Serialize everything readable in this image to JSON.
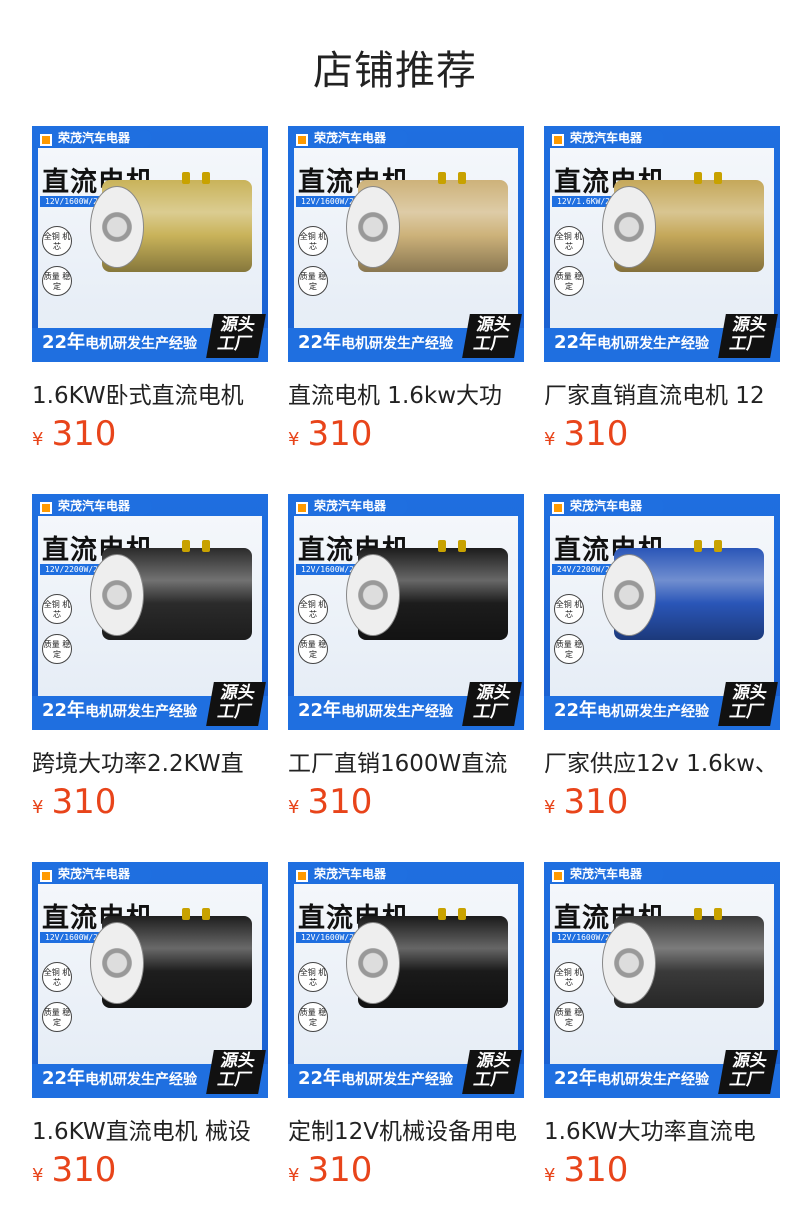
{
  "header": {
    "title": "店铺推荐"
  },
  "products": [
    {
      "brand": "荣茂汽车电器",
      "headline": "直流电机",
      "spec": "12V/1600W/2500RPM",
      "tag1": "全铜 机芯",
      "tag2": "质量 稳定",
      "years": "22年",
      "years_text": "电机研发生产经验",
      "source": "源头 工厂",
      "name": "1.6KW卧式直流电机",
      "currency": "¥",
      "price": "310",
      "motor_color": "#c9b35a"
    },
    {
      "brand": "荣茂汽车电器",
      "headline": "直流电机",
      "spec": "12V/1600W/2500RPM",
      "tag1": "全铜 机芯",
      "tag2": "质量 稳定",
      "years": "22年",
      "years_text": "电机研发生产经验",
      "source": "源头 工厂",
      "name": "直流电机 1.6kw大功",
      "currency": "¥",
      "price": "310",
      "motor_color": "#cdb27a"
    },
    {
      "brand": "荣茂汽车电器",
      "headline": "直流电机",
      "spec": "12V/1.6KW/2500RPM",
      "tag1": "全铜 机芯",
      "tag2": "质量 稳定",
      "years": "22年",
      "years_text": "电机研发生产经验",
      "source": "源头 工厂",
      "name": "厂家直销直流电机 12",
      "currency": "¥",
      "price": "310",
      "motor_color": "#c5a85a"
    },
    {
      "brand": "荣茂汽车电器",
      "headline": "直流电机",
      "spec": "12V/2200W/2700RPM",
      "tag1": "全铜 机芯",
      "tag2": "质量 稳定",
      "years": "22年",
      "years_text": "电机研发生产经验",
      "source": "源头 工厂",
      "name": "跨境大功率2.2KW直",
      "currency": "¥",
      "price": "310",
      "motor_color": "#2b2b2b"
    },
    {
      "brand": "荣茂汽车电器",
      "headline": "直流电机",
      "spec": "12V/1600W/2500RPM",
      "tag1": "全铜 机芯",
      "tag2": "质量 稳定",
      "years": "22年",
      "years_text": "电机研发生产经验",
      "source": "源头 工厂",
      "name": "工厂直销1600W直流",
      "currency": "¥",
      "price": "310",
      "motor_color": "#1c1c1c"
    },
    {
      "brand": "荣茂汽车电器",
      "headline": "直流电机",
      "spec": "24V/2200W/2700RPM",
      "tag1": "全铜 机芯",
      "tag2": "质量 稳定",
      "years": "22年",
      "years_text": "电机研发生产经验",
      "source": "源头 工厂",
      "name": "厂家供应12v 1.6kw、",
      "currency": "¥",
      "price": "310",
      "motor_color": "#2a56b8"
    },
    {
      "brand": "荣茂汽车电器",
      "headline": "直流电机",
      "spec": "12V/1600W/2500RPM",
      "tag1": "全铜 机芯",
      "tag2": "质量 稳定",
      "years": "22年",
      "years_text": "电机研发生产经验",
      "source": "源头 工厂",
      "name": "1.6KW直流电机 械设",
      "currency": "¥",
      "price": "310",
      "motor_color": "#1e1e1e"
    },
    {
      "brand": "荣茂汽车电器",
      "headline": "直流电机",
      "spec": "12V/1600W/2500RPM",
      "tag1": "全铜 机芯",
      "tag2": "质量 稳定",
      "years": "22年",
      "years_text": "电机研发生产经验",
      "source": "源头 工厂",
      "name": "定制12V机械设备用电",
      "currency": "¥",
      "price": "310",
      "motor_color": "#1a1a1a"
    },
    {
      "brand": "荣茂汽车电器",
      "headline": "直流电机",
      "spec": "12V/1600W/2500RPM",
      "tag1": "全铜 机芯",
      "tag2": "质量 稳定",
      "years": "22年",
      "years_text": "电机研发生产经验",
      "source": "源头 工厂",
      "name": "1.6KW大功率直流电",
      "currency": "¥",
      "price": "310",
      "motor_color": "#3a3a3a"
    }
  ]
}
